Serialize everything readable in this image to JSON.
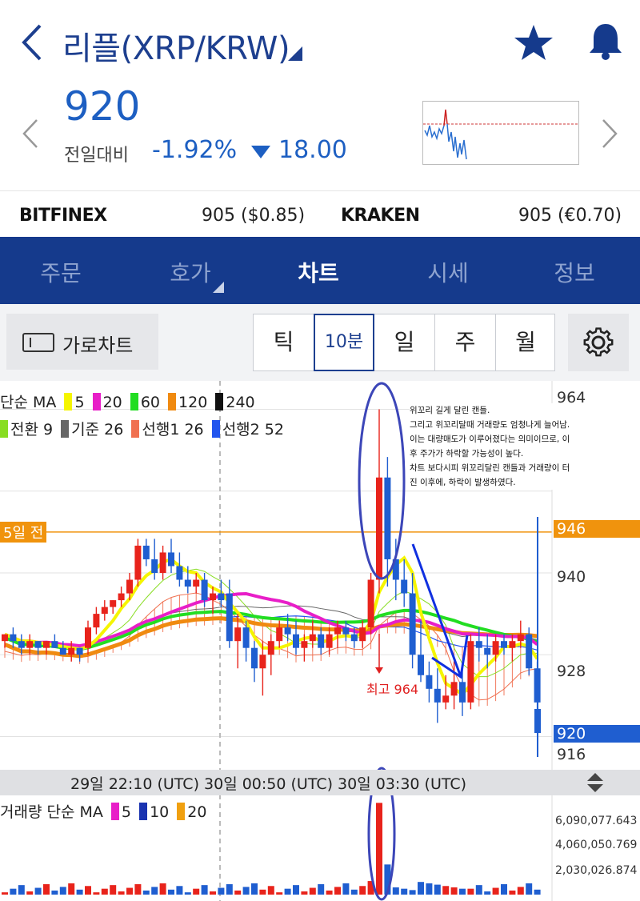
{
  "header": {
    "title": "리플(XRP/KRW)",
    "price": "920",
    "prev_label": "전일대비",
    "change_pct": "-1.92%",
    "change_abs": "18.00",
    "icons": [
      "back-chevron-icon",
      "dropdown-triangle-icon",
      "star-icon",
      "bell-icon",
      "chevron-left-icon",
      "chevron-right-icon"
    ],
    "down_color": "#1d5fc2"
  },
  "exchanges": [
    {
      "name": "BITFINEX",
      "value": "905 ($0.85)"
    },
    {
      "name": "KRAKEN",
      "value": "905 (€0.70)"
    }
  ],
  "tabs": [
    {
      "label": "주문",
      "active": false
    },
    {
      "label": "호가",
      "active": false
    },
    {
      "label": "차트",
      "active": true
    },
    {
      "label": "시세",
      "active": false
    },
    {
      "label": "정보",
      "active": false
    }
  ],
  "controls": {
    "landscape_label": "가로차트",
    "periods": [
      {
        "label": "틱",
        "active": false
      },
      {
        "label": "10분",
        "active": true
      },
      {
        "label": "일",
        "active": false
      },
      {
        "label": "주",
        "active": false
      },
      {
        "label": "월",
        "active": false
      }
    ]
  },
  "legend": {
    "ma_label": "단순 MA",
    "ma_items": [
      {
        "label": "5",
        "color": "#f5f500"
      },
      {
        "label": "20",
        "color": "#e81ec8"
      },
      {
        "label": "60",
        "color": "#22dd22"
      },
      {
        "label": "120",
        "color": "#f08a10"
      },
      {
        "label": "240",
        "color": "#111111"
      }
    ],
    "ichimoku_items": [
      {
        "label": "전환 9",
        "color": "#88dd22"
      },
      {
        "label": "기준 26",
        "color": "#666666"
      },
      {
        "label": "선행1 26",
        "color": "#f07050"
      },
      {
        "label": "선행2 52",
        "color": "#2255ee"
      }
    ],
    "volume_label": "거래량 단순 MA",
    "volume_items": [
      {
        "label": "5",
        "color": "#e81ec8"
      },
      {
        "label": "10",
        "color": "#1a33b0"
      },
      {
        "label": "20",
        "color": "#f0a010"
      }
    ]
  },
  "annotation": {
    "lines": [
      "위꼬리 길게 달린 캔들.",
      "그리고 위꼬리달때 거래량도 엄청나게 늘어남.",
      "이는 대량매도가 이루어졌다는 의미이므로, 이",
      "후 주가가 하락할 가능성이 높다.",
      "차트 보다시피 위꼬리달린 캔들과 거래량이 터",
      "진 이후에, 하락이 발생하였다."
    ],
    "high_label": "최고 964",
    "days_ago_label": "5일 전"
  },
  "axis": {
    "price_ticks": [
      "964",
      "946",
      "940",
      "928",
      "920",
      "916"
    ],
    "time_text": "29일 22:10 (UTC) 30일 00:50 (UTC) 30일 03:30 (UTC)",
    "volume_ticks": [
      "6,090,077.643",
      "4,060,050.769",
      "2,030,026.874"
    ],
    "current_price": "920",
    "mark_946": "946"
  },
  "chart_data": {
    "type": "candlestick",
    "interval": "10분",
    "ylim": [
      913,
      967
    ],
    "candles": [
      [
        0,
        930,
        931,
        929,
        931
      ],
      [
        1,
        931,
        932,
        929,
        930
      ],
      [
        2,
        930,
        931,
        928,
        929
      ],
      [
        3,
        929,
        931,
        928,
        930
      ],
      [
        4,
        930,
        930,
        928,
        929
      ],
      [
        5,
        929,
        930,
        928,
        930
      ],
      [
        6,
        930,
        931,
        929,
        929
      ],
      [
        7,
        929,
        930,
        928,
        928
      ],
      [
        8,
        928,
        930,
        927,
        929
      ],
      [
        9,
        929,
        929,
        927,
        928
      ],
      [
        10,
        929,
        933,
        928,
        932
      ],
      [
        11,
        932,
        935,
        931,
        934
      ],
      [
        12,
        934,
        936,
        933,
        935
      ],
      [
        13,
        935,
        936,
        934,
        936
      ],
      [
        14,
        936,
        938,
        935,
        937
      ],
      [
        15,
        937,
        940,
        936,
        939
      ],
      [
        16,
        939,
        945,
        938,
        944
      ],
      [
        17,
        944,
        945,
        941,
        942
      ],
      [
        18,
        942,
        945,
        939,
        940
      ],
      [
        19,
        940,
        944,
        939,
        943
      ],
      [
        20,
        943,
        945,
        940,
        941
      ],
      [
        21,
        941,
        943,
        938,
        939
      ],
      [
        22,
        939,
        941,
        937,
        938
      ],
      [
        23,
        938,
        940,
        937,
        939
      ],
      [
        24,
        939,
        940,
        935,
        936
      ],
      [
        25,
        936,
        938,
        934,
        937
      ],
      [
        26,
        937,
        939,
        935,
        936
      ],
      [
        27,
        937,
        939,
        929,
        930
      ],
      [
        28,
        930,
        934,
        926,
        932
      ],
      [
        29,
        932,
        933,
        927,
        929
      ],
      [
        30,
        929,
        930,
        924,
        926
      ],
      [
        31,
        926,
        930,
        922,
        928
      ],
      [
        32,
        928,
        931,
        925,
        930
      ],
      [
        33,
        930,
        933,
        929,
        932
      ],
      [
        34,
        932,
        934,
        930,
        931
      ],
      [
        35,
        931,
        933,
        928,
        929
      ],
      [
        36,
        929,
        931,
        927,
        930
      ],
      [
        37,
        930,
        933,
        929,
        931
      ],
      [
        38,
        931,
        932,
        928,
        929
      ],
      [
        39,
        929,
        932,
        928,
        931
      ],
      [
        40,
        931,
        933,
        929,
        932
      ],
      [
        41,
        932,
        933,
        930,
        931
      ],
      [
        42,
        931,
        932,
        929,
        930
      ],
      [
        43,
        930,
        933,
        929,
        932
      ],
      [
        44,
        932,
        940,
        931,
        939
      ],
      [
        45,
        939,
        964,
        937,
        954
      ],
      [
        46,
        954,
        957,
        938,
        942
      ],
      [
        47,
        942,
        945,
        936,
        939
      ],
      [
        48,
        939,
        942,
        935,
        937
      ],
      [
        49,
        937,
        940,
        926,
        928
      ],
      [
        50,
        928,
        933,
        924,
        925
      ],
      [
        51,
        925,
        927,
        921,
        923
      ],
      [
        52,
        923,
        926,
        918,
        921
      ],
      [
        53,
        921,
        925,
        920,
        922
      ],
      [
        54,
        922,
        927,
        920,
        924
      ],
      [
        55,
        924,
        926,
        919,
        921
      ],
      [
        56,
        921,
        931,
        920,
        930
      ],
      [
        57,
        930,
        932,
        927,
        929
      ],
      [
        58,
        929,
        931,
        926,
        928
      ],
      [
        59,
        928,
        931,
        927,
        930
      ],
      [
        60,
        930,
        931,
        928,
        929
      ],
      [
        61,
        929,
        931,
        927,
        930
      ],
      [
        62,
        930,
        933,
        929,
        931
      ],
      [
        63,
        931,
        932,
        925,
        926
      ],
      [
        64,
        926,
        927,
        920,
        921
      ]
    ],
    "volume_ylim": [
      0,
      7000000
    ]
  }
}
